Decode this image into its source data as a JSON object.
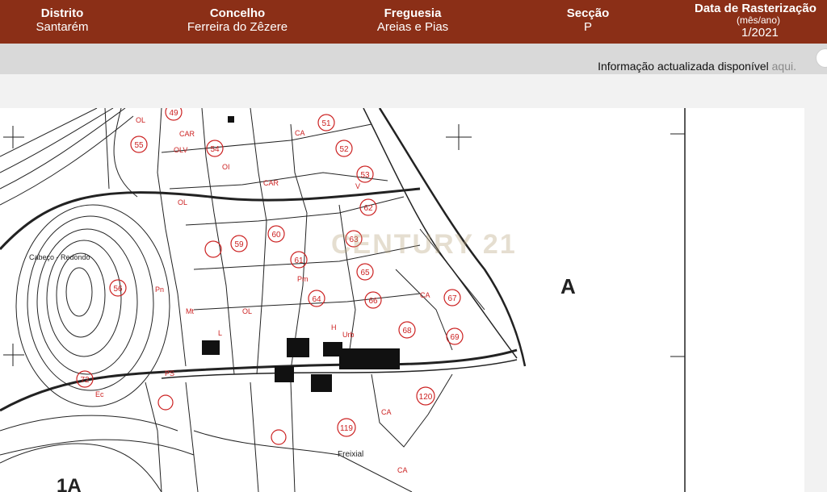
{
  "header": {
    "distrito_label": "Distrito",
    "distrito_value": "Santarém",
    "concelho_label": "Concelho",
    "concelho_value": "Ferreira do Zêzere",
    "freguesia_label": "Freguesia",
    "freguesia_value": "Areias e Pias",
    "seccao_label": "Secção",
    "seccao_value": "P",
    "data_label": "Data de Rasterização",
    "data_sub": "(mês/ano)",
    "data_value": "1/2021"
  },
  "info": {
    "text": "Informação actualizada disponível",
    "link": "aqui."
  },
  "map": {
    "watermark": "CENTURY 21",
    "section_a": "A",
    "section_1a": "1A",
    "place_cabeco": "Cabeço - Redondo",
    "place_freixial": "Freixial",
    "parcels": [
      "49",
      "51",
      "52",
      "53",
      "54",
      "55",
      "56",
      "59",
      "60",
      "61",
      "62",
      "63",
      "64",
      "65",
      "66",
      "67",
      "68",
      "69",
      "72",
      "119",
      "120"
    ],
    "labels": [
      "OL",
      "CA",
      "CAR",
      "OLV",
      "OI",
      "V",
      "Pn",
      "Mt",
      "Ec",
      "PS",
      "Urb",
      "Pm",
      "H",
      "L"
    ]
  },
  "colors": {
    "header_bg": "#8b2f17",
    "map_red": "#cc2222",
    "link": "#8a8a8a"
  }
}
